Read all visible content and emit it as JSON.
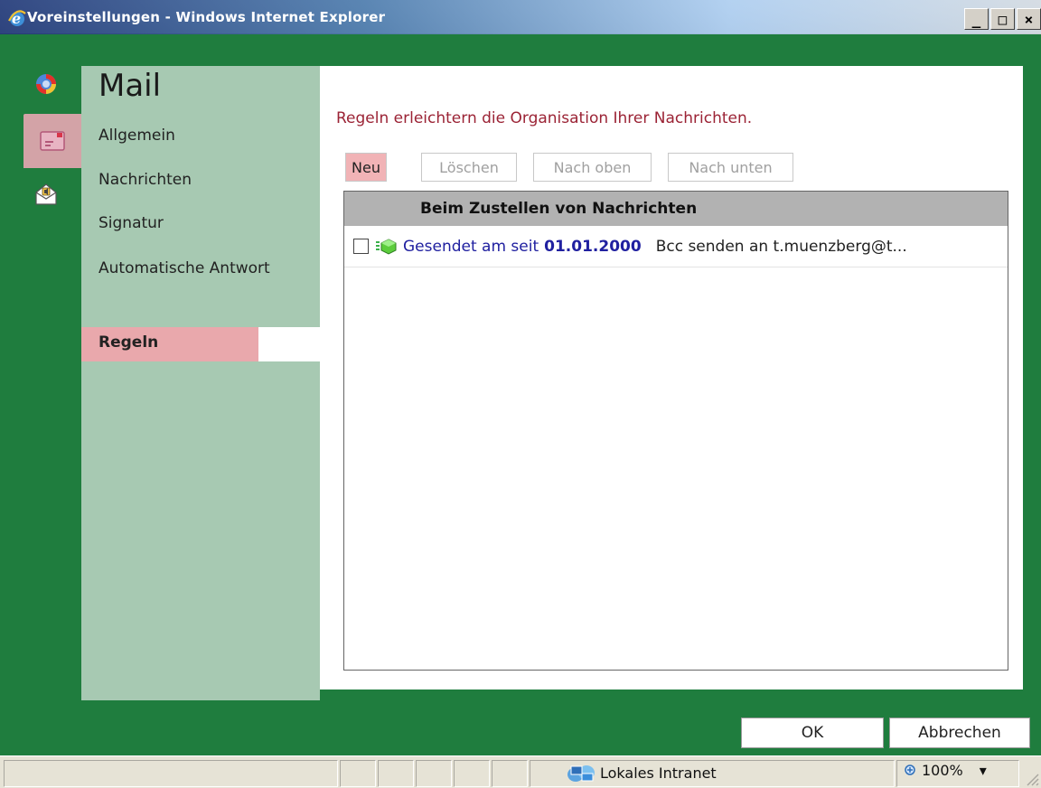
{
  "window": {
    "title": "Voreinstellungen - Windows Internet Explorer",
    "controls": {
      "minimize": "_",
      "maximize": "□",
      "close": "×"
    }
  },
  "rail": {
    "items": [
      {
        "icon": "refresh-globe-icon"
      },
      {
        "icon": "mail-envelope-icon",
        "active": true
      },
      {
        "icon": "voice-mail-icon"
      }
    ]
  },
  "nav": {
    "title": "Mail",
    "items": [
      {
        "label": "Allgemein"
      },
      {
        "label": "Nachrichten"
      },
      {
        "label": "Signatur"
      },
      {
        "label": "Automatische Antwort"
      },
      {
        "label": "Regeln",
        "active": true
      }
    ]
  },
  "content": {
    "intro": "Regeln erleichtern die Organisation Ihrer Nachrichten.",
    "toolbar": {
      "new": "Neu",
      "delete": "Löschen",
      "up": "Nach oben",
      "down": "Nach unten"
    },
    "table": {
      "header": "Beim Zustellen von Nachrichten",
      "rows": [
        {
          "checked": false,
          "condition": "Gesendet am seit",
          "date": "01.01.2000",
          "action": "Bcc senden an t.muenzberg@t..."
        }
      ]
    }
  },
  "footer": {
    "ok": "OK",
    "cancel": "Abbrechen"
  },
  "statusbar": {
    "zone": "Lokales Intranet",
    "zoom": "100%",
    "zoom_arrow": "▾"
  },
  "colors": {
    "frame_green": "#1f7d3e",
    "nav_bg": "#a7c9b2",
    "active_pink": "#e9a8ac",
    "intro_text": "#9b2335",
    "rule_link": "#2020a0"
  }
}
